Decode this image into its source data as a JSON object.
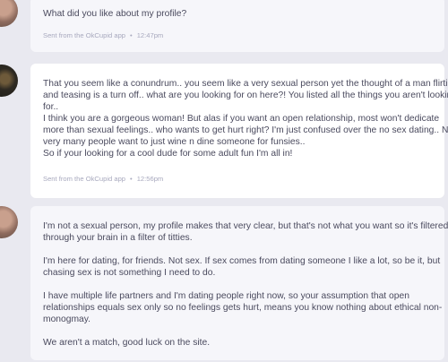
{
  "messages": [
    {
      "side": "theirs",
      "lines": [
        "What did you like about my profile?"
      ],
      "source": "Sent from the OkCupid app",
      "time": "12:47pm"
    },
    {
      "side": "mine",
      "lines": [
        "That you seem like a conundrum.. you seem like a very sexual person yet the thought of a man flirting",
        "and teasing is a turn off.. what are you looking for on here?! You listed all the things you aren't looking",
        "for..",
        "I think you are a gorgeous woman! But alas if you want an open relationship, most won't dedicate",
        "more than sexual feelings.. who wants to get hurt right? I'm just confused over the no sex dating.. Not",
        "very many people want to just wine n dine someone for funsies..",
        "So if your looking for a cool dude for some adult fun I'm all in!"
      ],
      "source": "Sent from the OkCupid app",
      "time": "12:56pm"
    },
    {
      "side": "theirs",
      "paragraphs": [
        [
          "I'm not a sexual person, my profile makes that very clear, but that's not what you want so it's filtered",
          "through your brain in a filter of titties."
        ],
        [
          "I'm here for dating, for friends. Not sex. If sex comes from dating someone I like a lot, so be it, but",
          "chasing sex is not something I need to do."
        ],
        [
          "I have multiple life partners and I'm dating people right now, so your assumption that open",
          "relationships equals sex only so no feelings gets hurt, means you know nothing about ethical non-",
          "monogmay."
        ],
        [
          "We aren't a match, good luck on the site."
        ]
      ]
    }
  ]
}
